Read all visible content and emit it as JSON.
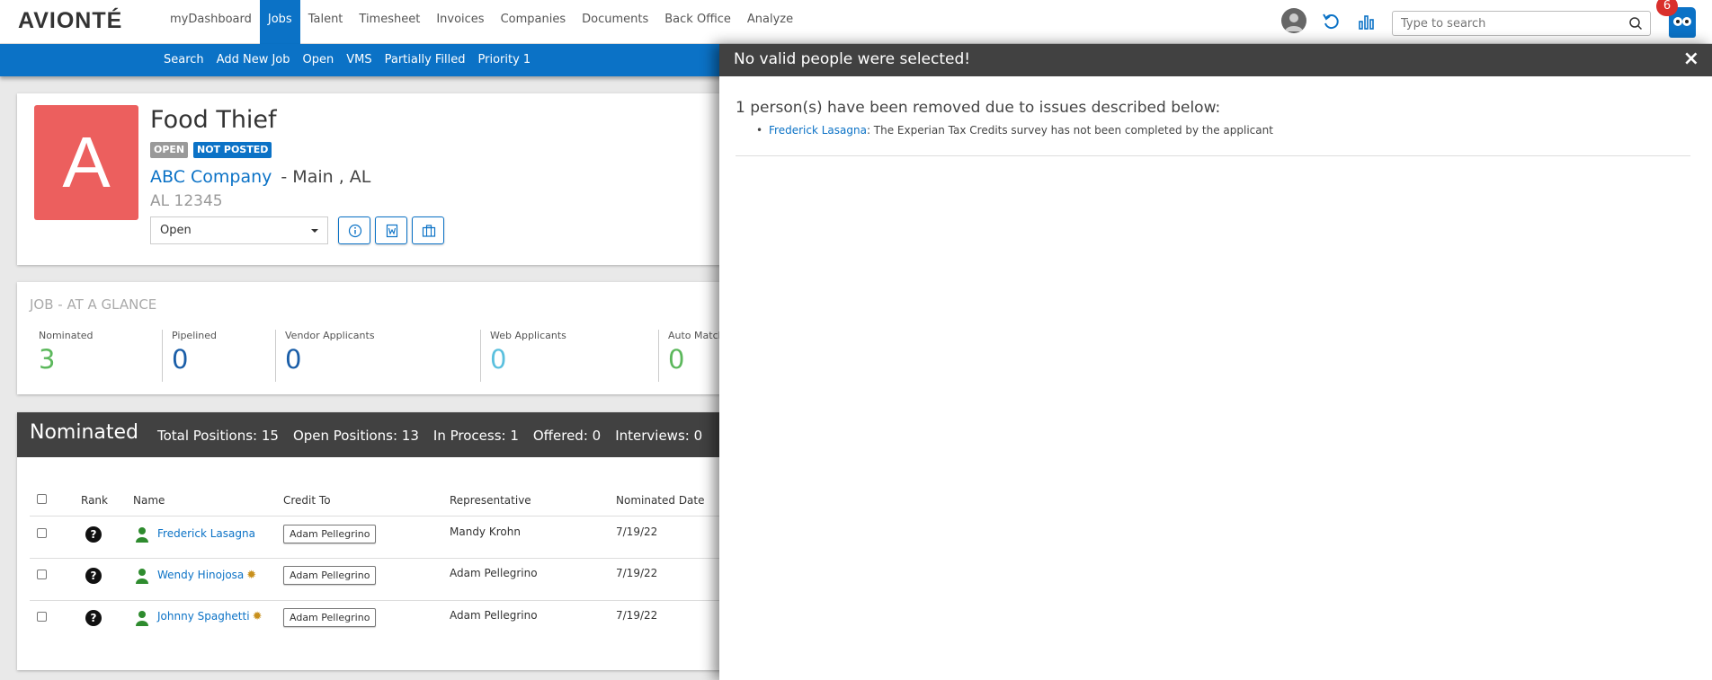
{
  "app": {
    "logo": "AVIONTÉ"
  },
  "topnav": {
    "items": [
      "myDashboard",
      "Jobs",
      "Talent",
      "Timesheet",
      "Invoices",
      "Companies",
      "Documents",
      "Back Office",
      "Analyze"
    ],
    "active": "Jobs",
    "search_placeholder": "Type to search",
    "notification_count": "6"
  },
  "subnav": {
    "items": [
      "Search",
      "Add New Job",
      "Open",
      "VMS",
      "Partially Filled",
      "Priority 1"
    ]
  },
  "job": {
    "avatar_letter": "A",
    "title": "Food Thief",
    "tag_open": "OPEN",
    "tag_notposted": "NOT POSTED",
    "company": "ABC Company",
    "location": "- Main , AL",
    "zip": "AL 12345",
    "status": "Open"
  },
  "glance": {
    "title": "JOB - AT A GLANCE",
    "stats": [
      {
        "label": "Nominated",
        "value": "3",
        "color": "#5cb85c"
      },
      {
        "label": "Pipelined",
        "value": "0",
        "color": "#1a5ea8"
      },
      {
        "label": "Vendor Applicants",
        "value": "0",
        "color": "#1a5ea8"
      },
      {
        "label": "Web Applicants",
        "value": "0",
        "color": "#5bc0de"
      },
      {
        "label": "Auto Match",
        "value": "0",
        "color": "#5cb85c"
      }
    ]
  },
  "nominated": {
    "title": "Nominated",
    "stats": [
      "Total Positions: 15",
      "Open Positions: 13",
      "In Process: 1",
      "Offered: 0",
      "Interviews: 0"
    ],
    "columns": [
      "Rank",
      "Name",
      "Credit To",
      "Representative",
      "Nominated Date"
    ],
    "rows": [
      {
        "rank": "?",
        "name": "Frederick Lasagna",
        "credit": "Adam Pellegrino",
        "rep": "Mandy Krohn",
        "date": "7/19/22",
        "star": false
      },
      {
        "rank": "?",
        "name": "Wendy Hinojosa",
        "credit": "Adam Pellegrino",
        "rep": "Adam Pellegrino",
        "date": "7/19/22",
        "star": true
      },
      {
        "rank": "?",
        "name": "Johnny Spaghetti",
        "credit": "Adam Pellegrino",
        "rep": "Adam Pellegrino",
        "date": "7/19/22",
        "star": true
      }
    ]
  },
  "modal": {
    "title": "No valid people were selected!",
    "close": "×",
    "message": "1 person(s) have been removed due to issues described below:",
    "issue_name": "Frederick Lasagna",
    "issue_text": ": The Experian Tax Credits survey has not been completed by the applicant"
  }
}
